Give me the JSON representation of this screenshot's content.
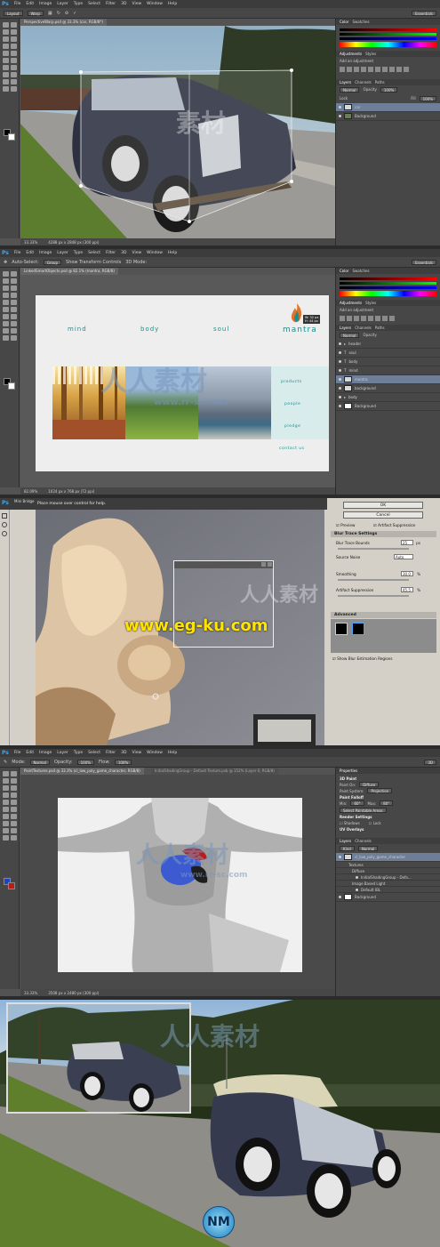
{
  "app_icon": "Ps",
  "menu": [
    "File",
    "Edit",
    "Image",
    "Layer",
    "Type",
    "Select",
    "Filter",
    "3D",
    "View",
    "Window",
    "Help"
  ],
  "panel_names": {
    "color": "Color",
    "swatches": "Swatches",
    "adjustments": "Adjustments",
    "styles": "Styles",
    "add_adjustment": "Add an adjustment",
    "layers": "Layers",
    "channels": "Channels",
    "paths": "Paths",
    "normal": "Normal",
    "opacity": "Opacity",
    "fill": "Fill",
    "lock": "Lock"
  },
  "shot1": {
    "doc_tab": "PerspectiveWarp.psd @ 33.3% (car, RGB/8*)",
    "toolbar": {
      "layout": "Layout",
      "warp": "Warp"
    },
    "workspace": "Essentials",
    "status": {
      "zoom": "33.33%",
      "size": "4288 px x 2848 px (300 ppi)"
    },
    "opacity": "100%",
    "fill": "100%",
    "layers": [
      "car",
      "Background"
    ],
    "watermark": "素材"
  },
  "shot2": {
    "doc_tab": "LinkedSmartObjects.psd @ 82.1% (mantra, RGB/8)",
    "toolbar": {
      "auto_select": "Auto-Select:",
      "group": "Group",
      "transform": "Show Transform Controls",
      "mode3d": "3D Mode:"
    },
    "workspace": "Essentials",
    "status": {
      "zoom": "82.09%",
      "size": "1024 px x 768 px (72 ppi)"
    },
    "site": {
      "nav_words": [
        "mind",
        "body",
        "soul"
      ],
      "brand": "mantra",
      "links": [
        "products",
        "people",
        "pledge",
        "contact us"
      ],
      "dims": "W: 32 px\nH: 44 px"
    },
    "layers": [
      "header",
      "soul",
      "body",
      "mind",
      "mantra",
      "background",
      "body",
      "Background"
    ],
    "watermark": "人人素材",
    "watermark_url": "www.rr-sc.com"
  },
  "shot3": {
    "title": "Mini Bridge",
    "hint": "Place mouse over control for help.",
    "ok": "OK",
    "cancel": "Cancel",
    "preview": "Preview",
    "artifact_suppression": "Artifact Suppression",
    "blur_trace_settings": "Blur Trace Settings",
    "blur_trace_bounds": {
      "label": "Blur Trace Bounds",
      "value": "25",
      "unit": "px"
    },
    "source_noise": {
      "label": "Source Noise",
      "value": "Auto"
    },
    "smoothing": {
      "label": "Smoothing",
      "value": "30.0",
      "unit": "%"
    },
    "artifact_value": {
      "label": "Artifact Suppression",
      "value": "45.5",
      "unit": "%"
    },
    "advanced": "Advanced",
    "show_regions": "Show Blur Estimation Regions",
    "watermark_site": "www.eg-ku.com",
    "watermark": "人人素材"
  },
  "shot4": {
    "doc_tab": "PaintTextures.psd @ 33.3% (cl_low_poly_game_character, RGB/8)",
    "doc_tab2": "InitialShadingGroup - Default Texture.psb @ 152% (Layer 0, RGB/8)",
    "toolbar": {
      "mode": "Mode:",
      "mode_value": "Normal",
      "opacity": "Opacity:",
      "opacity_value": "100%",
      "flow": "Flow:",
      "flow_value": "100%"
    },
    "workspace": "3D",
    "status": {
      "zoom": "33.33%",
      "size": "3508 px x 2480 px (300 ppi)"
    },
    "properties": {
      "title": "Properties",
      "paint3d": "3D Paint",
      "paint_on": "Paint On:",
      "paint_on_value": "Diffuse",
      "paint_system": "Paint System:",
      "paint_system_value": "Projection",
      "paint_falloff": "Paint Falloff",
      "min": "Min:",
      "min_value": "60°",
      "max": "Max:",
      "max_value": "80°",
      "select_paintable": "Select Paintable Areas",
      "render_settings": "Render Settings",
      "shadows": "Shadows",
      "lock": "Lock",
      "uv_overlays": "UV Overlays"
    },
    "layers": [
      "cl_low_poly_game_character",
      "Textures",
      "Diffuse",
      "InitialShadingGroup - Defa...",
      "Image Based Light",
      "Default IBL",
      "Background"
    ],
    "layers_kind": "Kind",
    "watermark": "人人素材",
    "watermark_url": "www.rr-sc.com"
  },
  "shot5": {
    "watermark": "人人素材",
    "logo_letters": "NM"
  }
}
